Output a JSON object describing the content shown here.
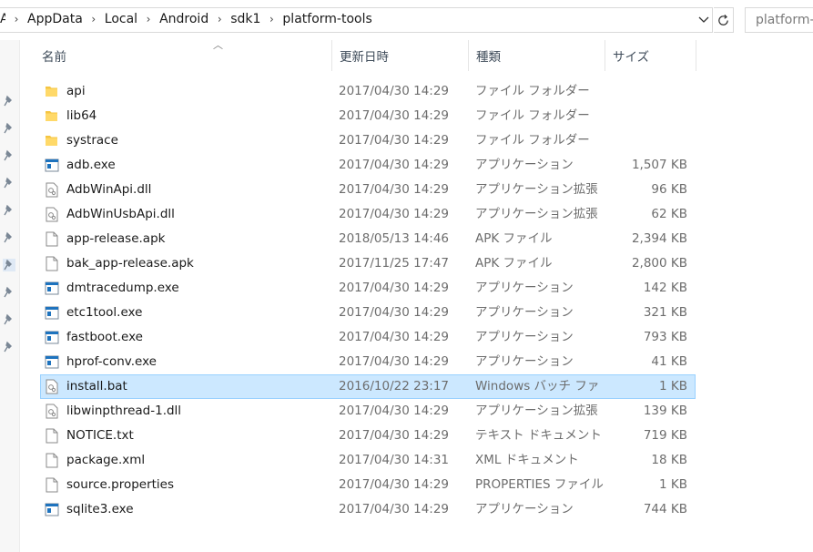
{
  "address_bar": {
    "breadcrumbs": [
      "AppData",
      "Local",
      "Android",
      "sdk1",
      "platform-tools"
    ],
    "first_crumb_fragment": "A"
  },
  "search": {
    "placeholder": "platform-tools"
  },
  "columns": {
    "name": "名前",
    "date": "更新日時",
    "type": "種類",
    "size": "サイズ"
  },
  "files": [
    {
      "name": "api",
      "date": "2017/04/30 14:29",
      "type": "ファイル フォルダー",
      "size": "",
      "icon": "folder-icon",
      "selected": false
    },
    {
      "name": "lib64",
      "date": "2017/04/30 14:29",
      "type": "ファイル フォルダー",
      "size": "",
      "icon": "folder-icon",
      "selected": false
    },
    {
      "name": "systrace",
      "date": "2017/04/30 14:29",
      "type": "ファイル フォルダー",
      "size": "",
      "icon": "folder-icon",
      "selected": false
    },
    {
      "name": "adb.exe",
      "date": "2017/04/30 14:29",
      "type": "アプリケーション",
      "size": "1,507 KB",
      "icon": "exe-icon",
      "selected": false
    },
    {
      "name": "AdbWinApi.dll",
      "date": "2017/04/30 14:29",
      "type": "アプリケーション拡張",
      "size": "96 KB",
      "icon": "dll-icon",
      "selected": false
    },
    {
      "name": "AdbWinUsbApi.dll",
      "date": "2017/04/30 14:29",
      "type": "アプリケーション拡張",
      "size": "62 KB",
      "icon": "dll-icon",
      "selected": false
    },
    {
      "name": "app-release.apk",
      "date": "2018/05/13 14:46",
      "type": "APK ファイル",
      "size": "2,394 KB",
      "icon": "file-icon",
      "selected": false
    },
    {
      "name": "bak_app-release.apk",
      "date": "2017/11/25 17:47",
      "type": "APK ファイル",
      "size": "2,800 KB",
      "icon": "file-icon",
      "selected": false
    },
    {
      "name": "dmtracedump.exe",
      "date": "2017/04/30 14:29",
      "type": "アプリケーション",
      "size": "142 KB",
      "icon": "exe-icon",
      "selected": false
    },
    {
      "name": "etc1tool.exe",
      "date": "2017/04/30 14:29",
      "type": "アプリケーション",
      "size": "321 KB",
      "icon": "exe-icon",
      "selected": false
    },
    {
      "name": "fastboot.exe",
      "date": "2017/04/30 14:29",
      "type": "アプリケーション",
      "size": "793 KB",
      "icon": "exe-icon",
      "selected": false
    },
    {
      "name": "hprof-conv.exe",
      "date": "2017/04/30 14:29",
      "type": "アプリケーション",
      "size": "41 KB",
      "icon": "exe-icon",
      "selected": false
    },
    {
      "name": "install.bat",
      "date": "2016/10/22 23:17",
      "type": "Windows バッチ ファ",
      "size": "1 KB",
      "icon": "bat-icon",
      "selected": true
    },
    {
      "name": "libwinpthread-1.dll",
      "date": "2017/04/30 14:29",
      "type": "アプリケーション拡張",
      "size": "139 KB",
      "icon": "dll-icon",
      "selected": false
    },
    {
      "name": "NOTICE.txt",
      "date": "2017/04/30 14:29",
      "type": "テキスト ドキュメント",
      "size": "719 KB",
      "icon": "file-icon",
      "selected": false
    },
    {
      "name": "package.xml",
      "date": "2017/04/30 14:31",
      "type": "XML ドキュメント",
      "size": "18 KB",
      "icon": "file-icon",
      "selected": false
    },
    {
      "name": "source.properties",
      "date": "2017/04/30 14:29",
      "type": "PROPERTIES ファイル",
      "size": "1 KB",
      "icon": "file-icon",
      "selected": false
    },
    {
      "name": "sqlite3.exe",
      "date": "2017/04/30 14:29",
      "type": "アプリケーション",
      "size": "744 KB",
      "icon": "exe-icon",
      "selected": false
    }
  ],
  "colors": {
    "selection_bg": "#cce8ff",
    "selection_border": "#99d1ff",
    "folder": "#f5c542",
    "exe_blue": "#1e73be"
  }
}
